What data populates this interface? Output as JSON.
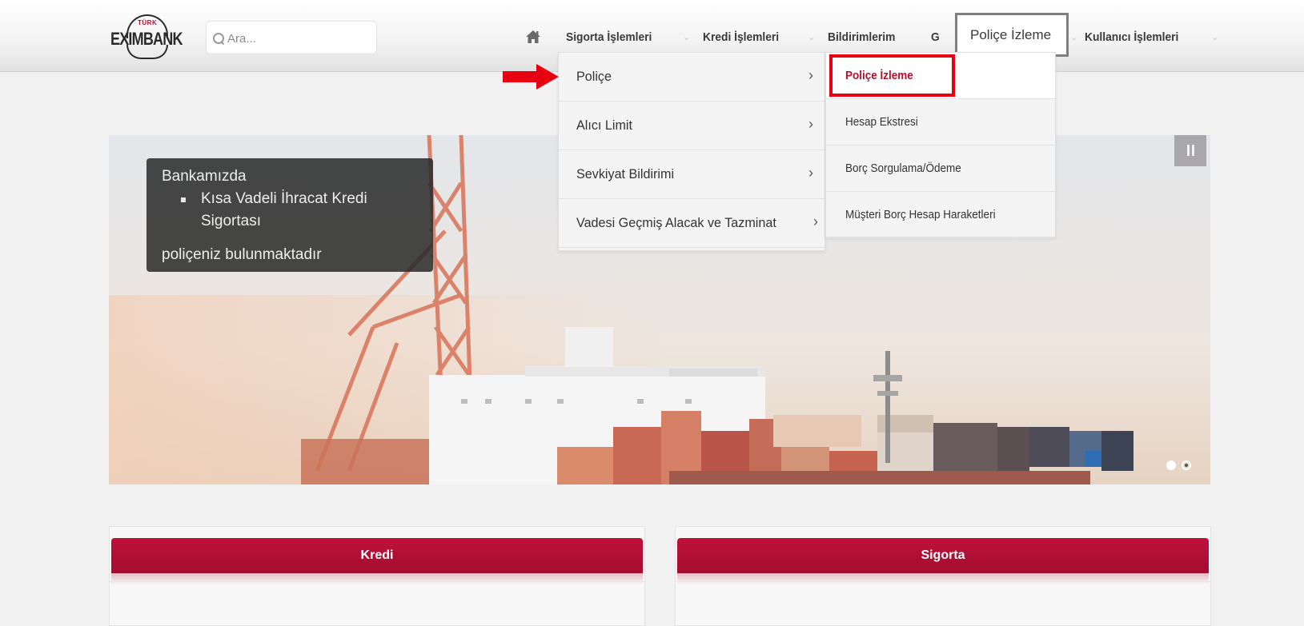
{
  "header": {
    "logo_small": "TÜRK",
    "logo_brand": "EXIMBANK",
    "search_placeholder": "Ara...",
    "nav": [
      {
        "label": "Sigorta İşlemleri"
      },
      {
        "label": "Kredi İşlemleri"
      },
      {
        "label": "Bildirimlerim"
      },
      {
        "label": "G"
      },
      {
        "label": "Kullanıcı İşlemleri"
      }
    ],
    "annotation_label": "Poliçe İzleme"
  },
  "menu_level1": [
    {
      "label": "Poliçe",
      "chevron": "›"
    },
    {
      "label": "Alıcı Limit",
      "chevron": "›"
    },
    {
      "label": "Sevkiyat Bildirimi",
      "chevron": "›"
    },
    {
      "label": "Vadesi Geçmiş Alacak ve Tazminat",
      "chevron": "›"
    }
  ],
  "menu_level2": [
    {
      "label": "Poliçe İzleme",
      "active": true
    },
    {
      "label": "Hesap Ekstresi"
    },
    {
      "label": "Borç Sorgulama/Ödeme"
    },
    {
      "label": "Müşteri Borç Hesap Haraketleri"
    }
  ],
  "hero": {
    "caption_line1": "Bankamızda",
    "caption_bullet_line1": "Kısa Vadeli İhracat Kredi",
    "caption_bullet_line2": "Sigortası",
    "caption_line2": "poliçeniz bulunmaktadır",
    "slide_count": 2,
    "active_slide": 1
  },
  "cards": [
    {
      "title": "Kredi"
    },
    {
      "title": "Sigorta"
    }
  ],
  "colors": {
    "brand_red": "#b0102e",
    "annotation_red": "#e60012",
    "annotation_gray": "#7f7f7f"
  }
}
